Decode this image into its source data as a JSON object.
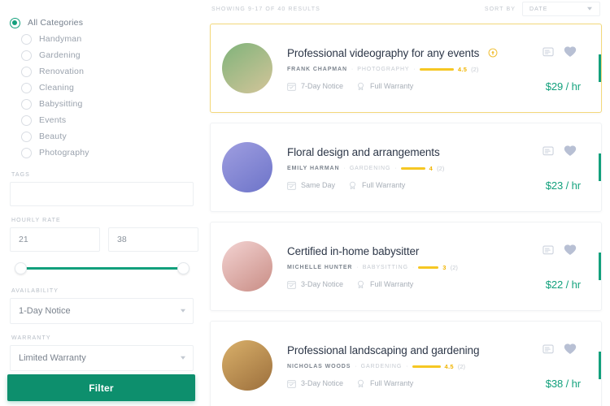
{
  "sidebar": {
    "categories": [
      {
        "label": "All Categories",
        "selected": true
      },
      {
        "label": "Handyman",
        "selected": false
      },
      {
        "label": "Gardening",
        "selected": false
      },
      {
        "label": "Renovation",
        "selected": false
      },
      {
        "label": "Cleaning",
        "selected": false
      },
      {
        "label": "Babysitting",
        "selected": false
      },
      {
        "label": "Events",
        "selected": false
      },
      {
        "label": "Beauty",
        "selected": false
      },
      {
        "label": "Photography",
        "selected": false
      }
    ],
    "tags": {
      "label": "TAGS",
      "value": "",
      "placeholder": ""
    },
    "hourly_rate": {
      "label": "HOURLY RATE",
      "min_value": "21",
      "max_value": "38"
    },
    "availability": {
      "label": "AVAILABILITY",
      "value": "1-Day Notice"
    },
    "warranty": {
      "label": "WARRANTY",
      "value": "Limited Warranty"
    },
    "filter_button": "Filter"
  },
  "topbar": {
    "showing": "SHOWING 9-17 OF 40 RESULTS",
    "sort_by_label": "SORT BY",
    "sort_value": "DATE"
  },
  "accent_colors": {
    "green": "#12a07c",
    "button_green": "#0d8f6d",
    "star_yellow": "#f6c723",
    "featured_border": "#f3d87a",
    "heart": "#b8c0d4"
  },
  "cards": [
    {
      "title": "Professional videography for any events",
      "featured": true,
      "badge": "verified-badge-icon",
      "author": "FRANK CHAPMAN",
      "category": "PHOTOGRAPHY",
      "rating": "4.5",
      "reviews": "(2)",
      "stars_width": 42,
      "notice": "7-Day Notice",
      "warranty": "Full Warranty",
      "price": "$29",
      "price_unit": "/ hr",
      "avatar_from": "#7fb37a",
      "avatar_to": "#d4c59a"
    },
    {
      "title": "Floral design and arrangements",
      "featured": false,
      "badge": "",
      "author": "EMILY HARMAN",
      "category": "GARDENING",
      "rating": "4",
      "reviews": "(2)",
      "stars_width": 30,
      "notice": "Same Day",
      "warranty": "Full Warranty",
      "price": "$23",
      "price_unit": "/ hr",
      "avatar_from": "#9f9ee0",
      "avatar_to": "#6d74c9"
    },
    {
      "title": "Certified in-home babysitter",
      "featured": false,
      "badge": "",
      "author": "MICHELLE HUNTER",
      "category": "BABYSITTING",
      "rating": "3",
      "reviews": "(2)",
      "stars_width": 25,
      "notice": "3-Day Notice",
      "warranty": "Full Warranty",
      "price": "$22",
      "price_unit": "/ hr",
      "avatar_from": "#f3d3d2",
      "avatar_to": "#c98d85"
    },
    {
      "title": "Professional landscaping and gardening",
      "featured": false,
      "badge": "",
      "author": "NICHOLAS WOODS",
      "category": "GARDENING",
      "rating": "4.5",
      "reviews": "(2)",
      "stars_width": 35,
      "notice": "3-Day Notice",
      "warranty": "Full Warranty",
      "price": "$38",
      "price_unit": "/ hr",
      "avatar_from": "#d9b06a",
      "avatar_to": "#9c6f3c"
    }
  ]
}
